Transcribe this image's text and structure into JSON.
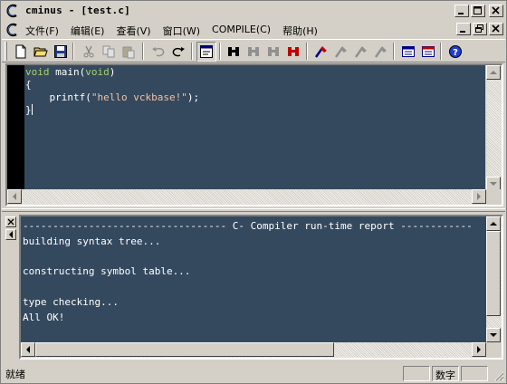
{
  "window": {
    "title": "cminus - [test.c]"
  },
  "menu": {
    "items": [
      "文件(F)",
      "编辑(E)",
      "查看(V)",
      "窗口(W)",
      "COMPILE(C)",
      "帮助(H)"
    ]
  },
  "toolbar": {
    "buttons": [
      "new-file-icon",
      "open-folder-icon",
      "save-icon",
      "cut-icon",
      "copy-icon",
      "paste-icon",
      "undo-icon",
      "redo-icon",
      "properties-icon",
      "find-binoculars-icon",
      "find-next-icon",
      "find-prev-icon",
      "replace-icon",
      "compile-icon",
      "build-icon",
      "build-all-icon",
      "stop-build-icon",
      "run-icon",
      "debug-icon",
      "help-icon"
    ]
  },
  "editor": {
    "lines": [
      {
        "kw": "void",
        "rest": " main(",
        "kw2": "void",
        "end": ")"
      },
      {
        "text": "{"
      },
      {
        "indent": "    ",
        "fn": "printf(",
        "str": "\"hello vckbase!\"",
        "end": ");"
      },
      {
        "text": "}"
      }
    ]
  },
  "output": {
    "lines": [
      "---------------------------------- C- Compiler run-time report ------------",
      "building syntax tree...",
      "",
      "constructing symbol table...",
      "",
      "type checking...",
      "All OK!"
    ]
  },
  "status": {
    "text": "就绪",
    "panels": [
      "",
      "数字",
      ""
    ]
  },
  "colors": {
    "editor_bg": "#34495e",
    "keyword": "#a6d36b",
    "string": "#f3c0a0",
    "chrome": "#d4d0c8"
  }
}
